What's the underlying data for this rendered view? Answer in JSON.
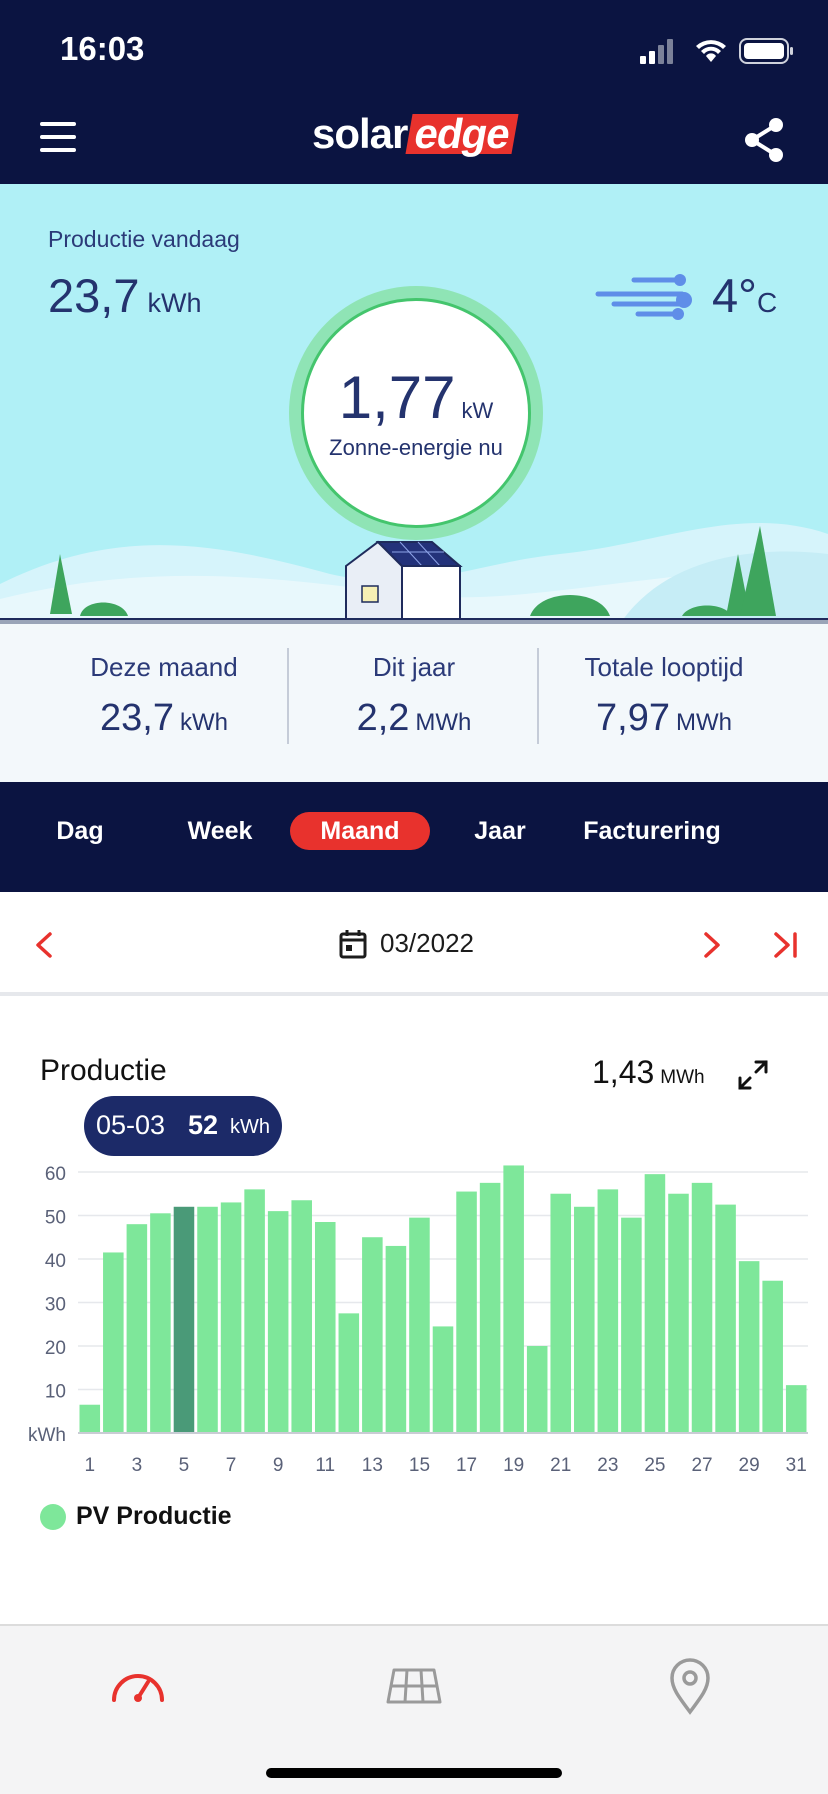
{
  "status": {
    "time": "16:03"
  },
  "header": {
    "logo_solar": "solar",
    "logo_edge": "edge"
  },
  "hero": {
    "production_label": "Productie vandaag",
    "production_value": "23,7",
    "production_unit": "kWh",
    "temperature_value": "4°",
    "temperature_unit": "C",
    "power_value": "1,77",
    "power_unit": "kW",
    "power_label": "Zonne-energie nu"
  },
  "stats": [
    {
      "label": "Deze maand",
      "value": "23,7",
      "unit": "kWh"
    },
    {
      "label": "Dit jaar",
      "value": "2,2",
      "unit": "MWh"
    },
    {
      "label": "Totale looptijd",
      "value": "7,97",
      "unit": "MWh"
    }
  ],
  "tabs": [
    {
      "label": "Dag",
      "active": false
    },
    {
      "label": "Week",
      "active": false
    },
    {
      "label": "Maand",
      "active": true
    },
    {
      "label": "Jaar",
      "active": false
    },
    {
      "label": "Facturering",
      "active": false
    }
  ],
  "date_nav": {
    "date": "03/2022"
  },
  "chart_card": {
    "title": "Productie",
    "total_value": "1,43",
    "total_unit": "MWh",
    "tooltip": {
      "date": "05-03",
      "value": "52",
      "unit": "kWh"
    },
    "legend_label": "PV Productie"
  },
  "colors": {
    "navy": "#0b1441",
    "accent_red": "#e8322d",
    "sky": "#b0f0f6",
    "bar": "#7ee79a",
    "bar_selected": "#4a9a78"
  },
  "chart_data": {
    "type": "bar",
    "title": "Productie",
    "ylabel": "kWh",
    "ylim": [
      0,
      60
    ],
    "yticks": [
      10,
      20,
      30,
      40,
      50,
      60
    ],
    "x_tick_labels": [
      "1",
      "3",
      "5",
      "7",
      "9",
      "11",
      "13",
      "15",
      "17",
      "19",
      "21",
      "23",
      "25",
      "27",
      "29",
      "31"
    ],
    "categories": [
      1,
      2,
      3,
      4,
      5,
      6,
      7,
      8,
      9,
      10,
      11,
      12,
      13,
      14,
      15,
      16,
      17,
      18,
      19,
      20,
      21,
      22,
      23,
      24,
      25,
      26,
      27,
      28,
      29,
      30,
      31
    ],
    "selected_index": 4,
    "series": [
      {
        "name": "PV Productie",
        "values": [
          6.5,
          41.5,
          48,
          50.5,
          52,
          52,
          53,
          56,
          51,
          53.5,
          48.5,
          27.5,
          45,
          43,
          49.5,
          24.5,
          55.5,
          57.5,
          61.5,
          20,
          55,
          52,
          56,
          49.5,
          59.5,
          55,
          57.5,
          52.5,
          39.5,
          35,
          11
        ]
      }
    ],
    "grid": true,
    "legend": "bottom-left"
  }
}
